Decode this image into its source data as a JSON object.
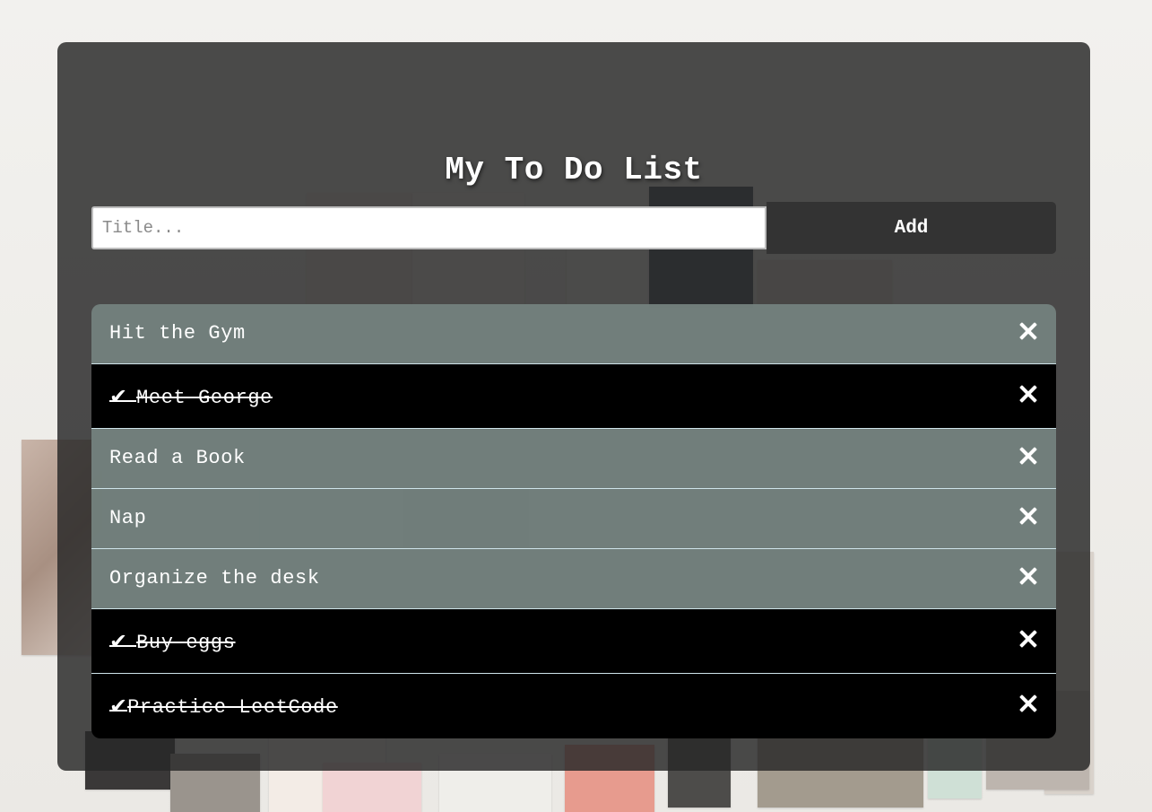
{
  "app": {
    "title": "My To Do List"
  },
  "add_form": {
    "placeholder": "Title...",
    "value": "",
    "button_label": "Add"
  },
  "todos": [
    {
      "text": "Hit the Gym",
      "done": false
    },
    {
      "text": "Meet George",
      "done": true
    },
    {
      "text": "Read a Book",
      "done": false
    },
    {
      "text": "Nap",
      "done": false
    },
    {
      "text": "Organize the desk",
      "done": false
    },
    {
      "text": "Buy eggs",
      "done": true
    },
    {
      "text": "Practice LeetCode",
      "done": true
    }
  ],
  "icons": {
    "check": "check-icon",
    "close": "close-icon"
  },
  "colors": {
    "panel": "#282828",
    "open_item": "#73807d",
    "done_item": "#000000",
    "add_button": "#333333",
    "text": "#ffffff"
  }
}
